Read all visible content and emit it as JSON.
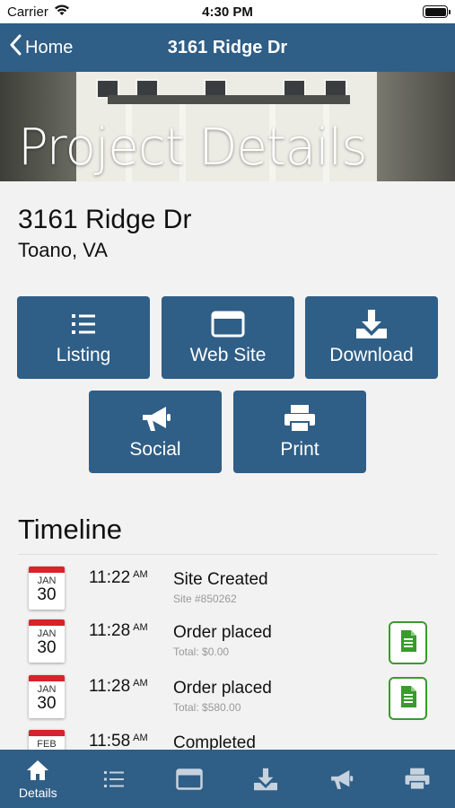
{
  "status": {
    "carrier": "Carrier",
    "time": "4:30 PM"
  },
  "nav": {
    "back_label": "Home",
    "title": "3161 Ridge Dr"
  },
  "hero": {
    "title": "Project Details"
  },
  "address": {
    "street": "3161 Ridge Dr",
    "city": "Toano, VA"
  },
  "actions": {
    "listing": "Listing",
    "website": "Web Site",
    "download": "Download",
    "social": "Social",
    "print": "Print"
  },
  "timeline": {
    "title": "Timeline",
    "items": [
      {
        "month": "JAN",
        "day": "30",
        "time": "11:22",
        "ampm": "AM",
        "title": "Site Created",
        "subtitle": "Site #850262",
        "has_doc": false
      },
      {
        "month": "JAN",
        "day": "30",
        "time": "11:28",
        "ampm": "AM",
        "title": "Order placed",
        "subtitle": "Total: $0.00",
        "has_doc": true
      },
      {
        "month": "JAN",
        "day": "30",
        "time": "11:28",
        "ampm": "AM",
        "title": "Order placed",
        "subtitle": "Total: $580.00",
        "has_doc": true
      },
      {
        "month": "FEB",
        "day": "",
        "time": "11:58",
        "ampm": "AM",
        "title": "Completed",
        "subtitle": "",
        "has_doc": false
      }
    ]
  },
  "tabbar": {
    "details_label": "Details",
    "tabs": [
      "details-icon",
      "list-icon",
      "window-icon",
      "download-icon",
      "megaphone-icon",
      "printer-icon"
    ]
  },
  "colors": {
    "primary": "#2f5e86",
    "calendar_red": "#d8232a",
    "doc_green": "#3a9a2e"
  }
}
